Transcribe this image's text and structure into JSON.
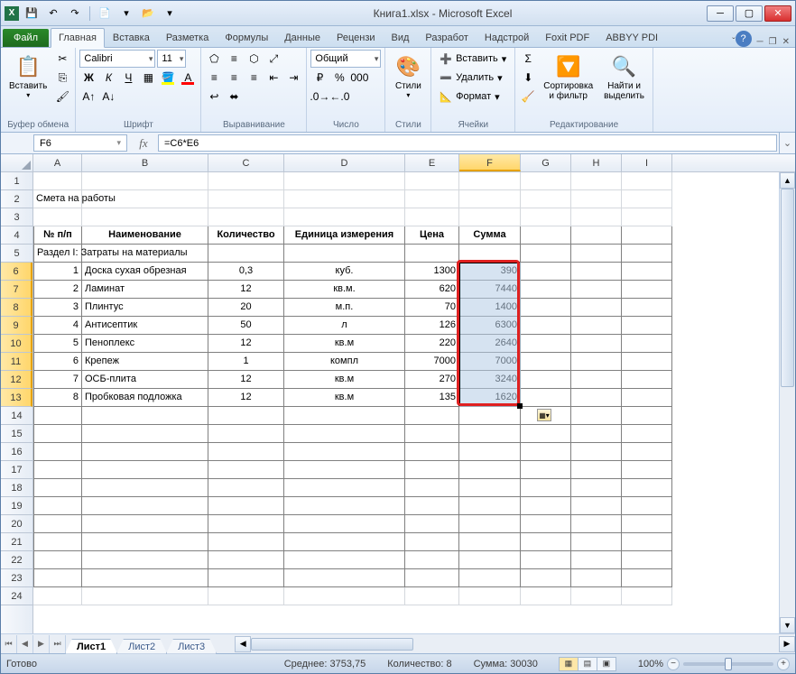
{
  "title": "Книга1.xlsx - Microsoft Excel",
  "tabs": {
    "file": "Файл",
    "home": "Главная",
    "insert": "Вставка",
    "layout": "Разметка",
    "formulas": "Формулы",
    "data": "Данные",
    "review": "Рецензи",
    "view": "Вид",
    "developer": "Разработ",
    "addins": "Надстрой",
    "foxit": "Foxit PDF",
    "abbyy": "ABBYY PDI"
  },
  "ribbon": {
    "paste": "Вставить",
    "clipboard": "Буфер обмена",
    "font_name": "Calibri",
    "font_size": "11",
    "font": "Шрифт",
    "alignment": "Выравнивание",
    "num_format": "Общий",
    "number": "Число",
    "styles": "Стили",
    "styles_btn": "Стили",
    "insert_btn": "Вставить",
    "delete_btn": "Удалить",
    "format_btn": "Формат",
    "cells": "Ячейки",
    "sort": "Сортировка\nи фильтр",
    "find": "Найти и\nвыделить",
    "editing": "Редактирование"
  },
  "namebox": "F6",
  "formula": "=C6*E6",
  "columns": [
    {
      "l": "A",
      "w": 54
    },
    {
      "l": "B",
      "w": 140
    },
    {
      "l": "C",
      "w": 84
    },
    {
      "l": "D",
      "w": 134
    },
    {
      "l": "E",
      "w": 60
    },
    {
      "l": "F",
      "w": 68
    },
    {
      "l": "G",
      "w": 56
    },
    {
      "l": "H",
      "w": 56
    },
    {
      "l": "I",
      "w": 56
    }
  ],
  "selected_col": "F",
  "selected_rows": [
    6,
    7,
    8,
    9,
    10,
    11,
    12,
    13
  ],
  "title_row": "Смета на работы",
  "headers": [
    "№ п/п",
    "Наименование",
    "Количество",
    "Единица измерения",
    "Цена",
    "Сумма"
  ],
  "section": "Раздел I: Затраты на материалы",
  "rows": [
    {
      "n": 1,
      "name": "Доска сухая обрезная",
      "qty": "0,3",
      "unit": "куб.",
      "price": 1300,
      "sum": 390
    },
    {
      "n": 2,
      "name": "Ламинат",
      "qty": "12",
      "unit": "кв.м.",
      "price": 620,
      "sum": 7440
    },
    {
      "n": 3,
      "name": "Плинтус",
      "qty": "20",
      "unit": "м.п.",
      "price": 70,
      "sum": 1400
    },
    {
      "n": 4,
      "name": "Антисептик",
      "qty": "50",
      "unit": "л",
      "price": 126,
      "sum": 6300
    },
    {
      "n": 5,
      "name": "Пеноплекс",
      "qty": "12",
      "unit": "кв.м",
      "price": 220,
      "sum": 2640
    },
    {
      "n": 6,
      "name": "Крепеж",
      "qty": "1",
      "unit": "компл",
      "price": 7000,
      "sum": 7000
    },
    {
      "n": 7,
      "name": "ОСБ-плита",
      "qty": "12",
      "unit": "кв.м",
      "price": 270,
      "sum": 3240
    },
    {
      "n": 8,
      "name": "Пробковая подложка",
      "qty": "12",
      "unit": "кв.м",
      "price": 135,
      "sum": 1620
    }
  ],
  "sheets": [
    "Лист1",
    "Лист2",
    "Лист3"
  ],
  "active_sheet": 0,
  "status": {
    "ready": "Готово",
    "avg_lbl": "Среднее:",
    "avg": "3753,75",
    "count_lbl": "Количество:",
    "count": "8",
    "sum_lbl": "Сумма:",
    "sum": "30030",
    "zoom": "100%"
  }
}
